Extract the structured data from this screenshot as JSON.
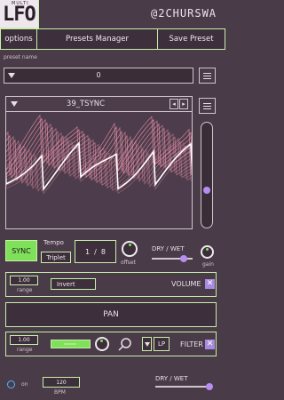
{
  "logo": {
    "small": "MULTI",
    "big": "LFO"
  },
  "brand": "@2CHURSWA",
  "top_bar": {
    "options": "options",
    "presets_manager": "Presets Manager",
    "save_preset": "Save Preset"
  },
  "preset": {
    "label": "preset name",
    "value": "0"
  },
  "lfo": {
    "name": "39_TSYNC"
  },
  "controls": {
    "sync_label": "SYNC",
    "tempo_label": "Tempo",
    "triplet_label": "Triplet",
    "rate_num": "1",
    "rate_sep": "/",
    "rate_den": "8",
    "offset_label": "offset",
    "dry_wet_label": "DRY / WET",
    "gain_label": "gain"
  },
  "volume_row": {
    "range_value": "1.00",
    "range_label": "range",
    "invert_label": "Invert",
    "title": "VOLUME"
  },
  "pan_row": {
    "title": "PAN"
  },
  "filter_row": {
    "range_value": "1.00",
    "range_label": "range",
    "type_value": "LP",
    "title": "FILTER"
  },
  "footer": {
    "bpm_value": "120",
    "bpm_label": "BPM",
    "on_label": "on",
    "dry_wet_label": "DRY / WET"
  },
  "colors": {
    "accent": "#c8f0a8",
    "lime": "#7fe05a",
    "purple": "#a98ae0",
    "bg": "#4a3b48"
  }
}
